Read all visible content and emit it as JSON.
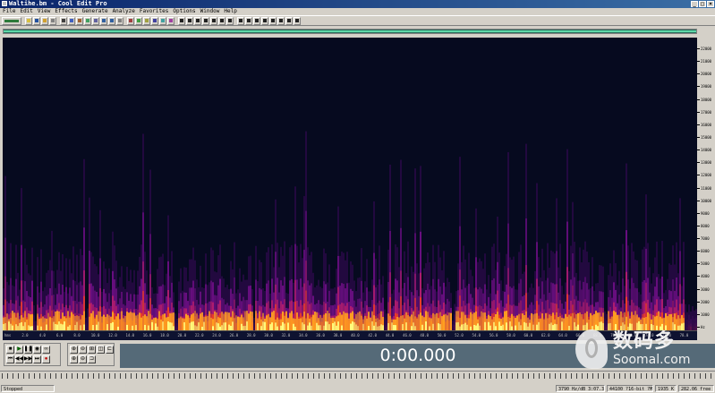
{
  "window": {
    "title": "Waltihe.bm - Cool Edit Pro",
    "controls": [
      "_",
      "□",
      "×"
    ]
  },
  "menu": [
    "File",
    "Edit",
    "View",
    "Effects",
    "Generate",
    "Analyze",
    "Favorites",
    "Options",
    "Window",
    "Help"
  ],
  "toolbar": {
    "groups": [
      [
        {
          "icon": "wave-view-icon",
          "color": "#2d7a3a"
        }
      ],
      [
        {
          "icon": "open-icon",
          "color": "#d8c040"
        },
        {
          "icon": "save-icon",
          "color": "#2050a0"
        },
        {
          "icon": "folder-icon",
          "color": "#d0a030"
        },
        {
          "icon": "cd-icon",
          "color": "#808080"
        }
      ],
      [
        {
          "icon": "cut-icon",
          "color": "#404040"
        },
        {
          "icon": "copy-icon",
          "color": "#4060c0"
        },
        {
          "icon": "paste-icon",
          "color": "#a06030"
        },
        {
          "icon": "mix-paste-icon",
          "color": "#40a060"
        },
        {
          "icon": "trim-icon",
          "color": "#6060a0"
        },
        {
          "icon": "undo-icon",
          "color": "#3060a0"
        },
        {
          "icon": "redo-icon",
          "color": "#3060a0"
        },
        {
          "icon": "silence-icon",
          "color": "#808080"
        }
      ],
      [
        {
          "icon": "normalize-icon",
          "color": "#a04040"
        },
        {
          "icon": "amplify-icon",
          "color": "#40a040"
        },
        {
          "icon": "noise-icon",
          "color": "#a0a040"
        },
        {
          "icon": "eq-icon",
          "color": "#4040a0"
        },
        {
          "icon": "filter-icon",
          "color": "#40a0a0"
        },
        {
          "icon": "reverb-icon",
          "color": "#a040a0"
        }
      ],
      [
        {
          "icon": "spectral-view-icon",
          "color": "#202020"
        },
        {
          "icon": "frequency-icon",
          "color": "#202020"
        },
        {
          "icon": "pan-icon",
          "color": "#202020"
        },
        {
          "icon": "phase-icon",
          "color": "#202020"
        },
        {
          "icon": "marker-icon",
          "color": "#202020"
        },
        {
          "icon": "grid-icon",
          "color": "#202020"
        },
        {
          "icon": "snap-icon",
          "color": "#202020"
        }
      ],
      [
        {
          "icon": "meter-icon",
          "color": "#202020"
        },
        {
          "icon": "scroll-icon",
          "color": "#202020"
        },
        {
          "icon": "time-icon",
          "color": "#202020"
        },
        {
          "icon": "selection-icon",
          "color": "#202020"
        },
        {
          "icon": "info-icon",
          "color": "#202020"
        },
        {
          "icon": "cue-icon",
          "color": "#202020"
        },
        {
          "icon": "playlist-icon",
          "color": "#202020"
        },
        {
          "icon": "help-icon",
          "color": "#202020"
        }
      ]
    ]
  },
  "overview": {
    "viewed_fraction": 1.0,
    "color": "#5ed7a8"
  },
  "spectrogram": {
    "background": "#060a1f",
    "palette": [
      "#3a0a5a",
      "#7a1090",
      "#c0206a",
      "#f04020",
      "#ffa020",
      "#ffff80"
    ],
    "frequency_labels": [
      "22000",
      "21000",
      "20000",
      "19000",
      "18000",
      "17000",
      "16000",
      "15000",
      "14000",
      "13000",
      "12000",
      "11000",
      "10000",
      "9000",
      "8000",
      "7000",
      "6000",
      "5000",
      "4000",
      "3000",
      "2000",
      "1000",
      "Hz"
    ],
    "time_labels": [
      "hms",
      "2.0",
      "4.0",
      "6.0",
      "8.0",
      "10.0",
      "12.0",
      "14.0",
      "16.0",
      "18.0",
      "20.0",
      "22.0",
      "24.0",
      "26.0",
      "28.0",
      "30.0",
      "32.0",
      "34.0",
      "36.0",
      "38.0",
      "40.0",
      "42.0",
      "44.0",
      "46.0",
      "48.0",
      "50.0",
      "52.0",
      "54.0",
      "56.0",
      "58.0",
      "60.0",
      "62.0",
      "64.0",
      "66.0",
      "68.0",
      "70.0",
      "72.0",
      "74.0",
      "76.0",
      "78.0"
    ]
  },
  "transport": {
    "buttons": [
      {
        "name": "stop-button",
        "glyph": "■"
      },
      {
        "name": "play-button",
        "glyph": "▶"
      },
      {
        "name": "pause-button",
        "glyph": "❚❚"
      },
      {
        "name": "play-to-end-button",
        "glyph": "◉"
      },
      {
        "name": "play-looped-button",
        "glyph": "∞"
      },
      {
        "name": "spacer",
        "glyph": ""
      },
      {
        "name": "go-to-start-button",
        "glyph": "⏮"
      },
      {
        "name": "rewind-button",
        "glyph": "◀◀"
      },
      {
        "name": "fast-forward-button",
        "glyph": "▶▶"
      },
      {
        "name": "go-to-end-button",
        "glyph": "⏭"
      },
      {
        "name": "record-button",
        "glyph": "●"
      },
      {
        "name": "spacer2",
        "glyph": ""
      }
    ],
    "zoom": [
      {
        "name": "zoom-in-horizontal-button",
        "glyph": "⊕"
      },
      {
        "name": "zoom-out-horizontal-button",
        "glyph": "⊖"
      },
      {
        "name": "zoom-full-button",
        "glyph": "⊞"
      },
      {
        "name": "zoom-selection-button",
        "glyph": "◫"
      },
      {
        "name": "zoom-left-button",
        "glyph": "⊏"
      },
      {
        "name": "zoom-in-vertical-button",
        "glyph": "⊕"
      },
      {
        "name": "zoom-out-vertical-button",
        "glyph": "⊖"
      },
      {
        "name": "zoom-right-button",
        "glyph": "⊐"
      }
    ]
  },
  "time_display": "0:00.000",
  "status": {
    "state": "Stopped",
    "cells": [
      "3790 Hz/dB  3:07.335",
      "44100 ?16-bit ?Mono",
      "1935 K",
      "282.06 free"
    ]
  },
  "watermark": {
    "cn": "数码多",
    "en": "Soomal.com"
  }
}
